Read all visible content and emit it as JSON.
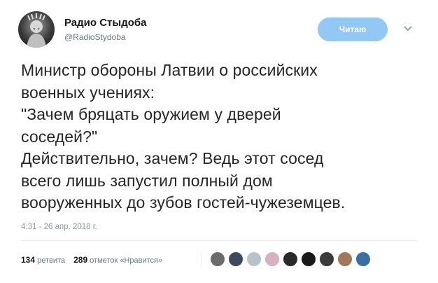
{
  "author": {
    "name": "Радио Стыдоба",
    "handle": "@RadioStydoba"
  },
  "follow_button": {
    "label": "Читаю"
  },
  "tweet": {
    "text": "Министр обороны Латвии о российских\nвоенных учениях:\n\"Зачем бряцать оружием у дверей\nсоседей?\"\nДействительно, зачем? Ведь этот сосед\nвсего лишь запустил полный дом\nвооруженных до зубов гостей-чужеземцев.",
    "timestamp": "4:31 - 26 апр. 2018 г."
  },
  "stats": {
    "retweets_count": "134",
    "retweets_label": "ретвита",
    "likes_count": "289",
    "likes_label": "отметок «Нравится»"
  },
  "colors": {
    "follow_button_bg": "#92c8f3",
    "secondary_text": "#657786",
    "timestamp_text": "#8899a6"
  },
  "icons": {
    "more_menu": "chevron-down-icon"
  },
  "liker_avatars": [
    {
      "color": "#6b6b6b"
    },
    {
      "color": "#3d4a5c"
    },
    {
      "color": "#b8c2cc"
    },
    {
      "color": "#d7b2c0"
    },
    {
      "color": "#2a2a2a"
    },
    {
      "color": "#1a1a1a"
    },
    {
      "color": "#3b3b3b"
    },
    {
      "color": "#a0785a"
    },
    {
      "color": "#3a6ea5"
    }
  ]
}
